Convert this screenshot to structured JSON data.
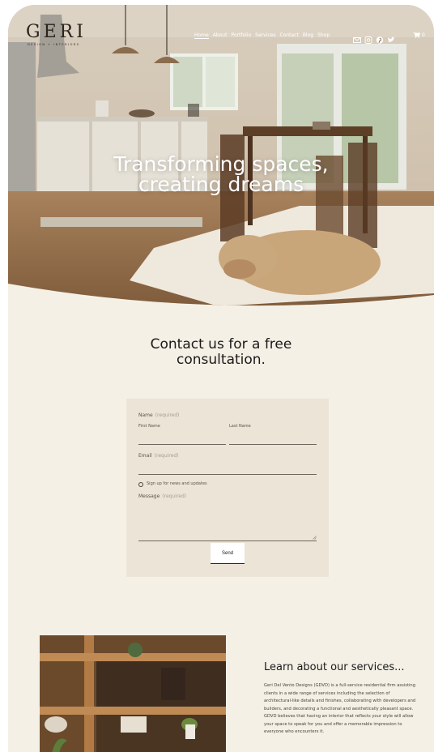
{
  "brand": {
    "name": "GERI",
    "tagline": "DESIGN + INTERIORS"
  },
  "nav": {
    "items": [
      {
        "label": "Home",
        "active": true
      },
      {
        "label": "About"
      },
      {
        "label": "Portfolio"
      },
      {
        "label": "Services"
      },
      {
        "label": "Contact"
      },
      {
        "label": "Blog"
      },
      {
        "label": "Shop"
      }
    ],
    "social_icons": [
      "email-icon",
      "instagram-icon",
      "pinterest-icon",
      "twitter-icon"
    ],
    "cart_count": "0"
  },
  "hero": {
    "title_line1": "Transforming spaces,",
    "title_line2": "creating dreams"
  },
  "contact": {
    "title_line1": "Contact us for a free",
    "title_line2": "consultation.",
    "form": {
      "name_label": "Name",
      "name_required": "(required)",
      "first_name_label": "First Name",
      "last_name_label": "Last Name",
      "email_label": "Email",
      "email_required": "(required)",
      "newsletter_label": "Sign up for news and updates",
      "message_label": "Message",
      "message_required": "(required)",
      "send_label": "Send"
    }
  },
  "services": {
    "title": "Learn about our services...",
    "body": "Geri Del Vento Designs (GDVD) is a full-service residential firm assisting clients in a wide range of services including the selection of architectural-like details and finishes, collaborating with developers and builders, and decorating a functional and aesthetically pleasant space. GDVD believes that having an interior that reflects your style will allow your space to speak for you and offer a memorable impression to everyone who encounters it."
  },
  "colors": {
    "page_bg": "#f4f0e6",
    "form_bg": "#ece4d7",
    "text_dark": "#1a1a1a"
  }
}
